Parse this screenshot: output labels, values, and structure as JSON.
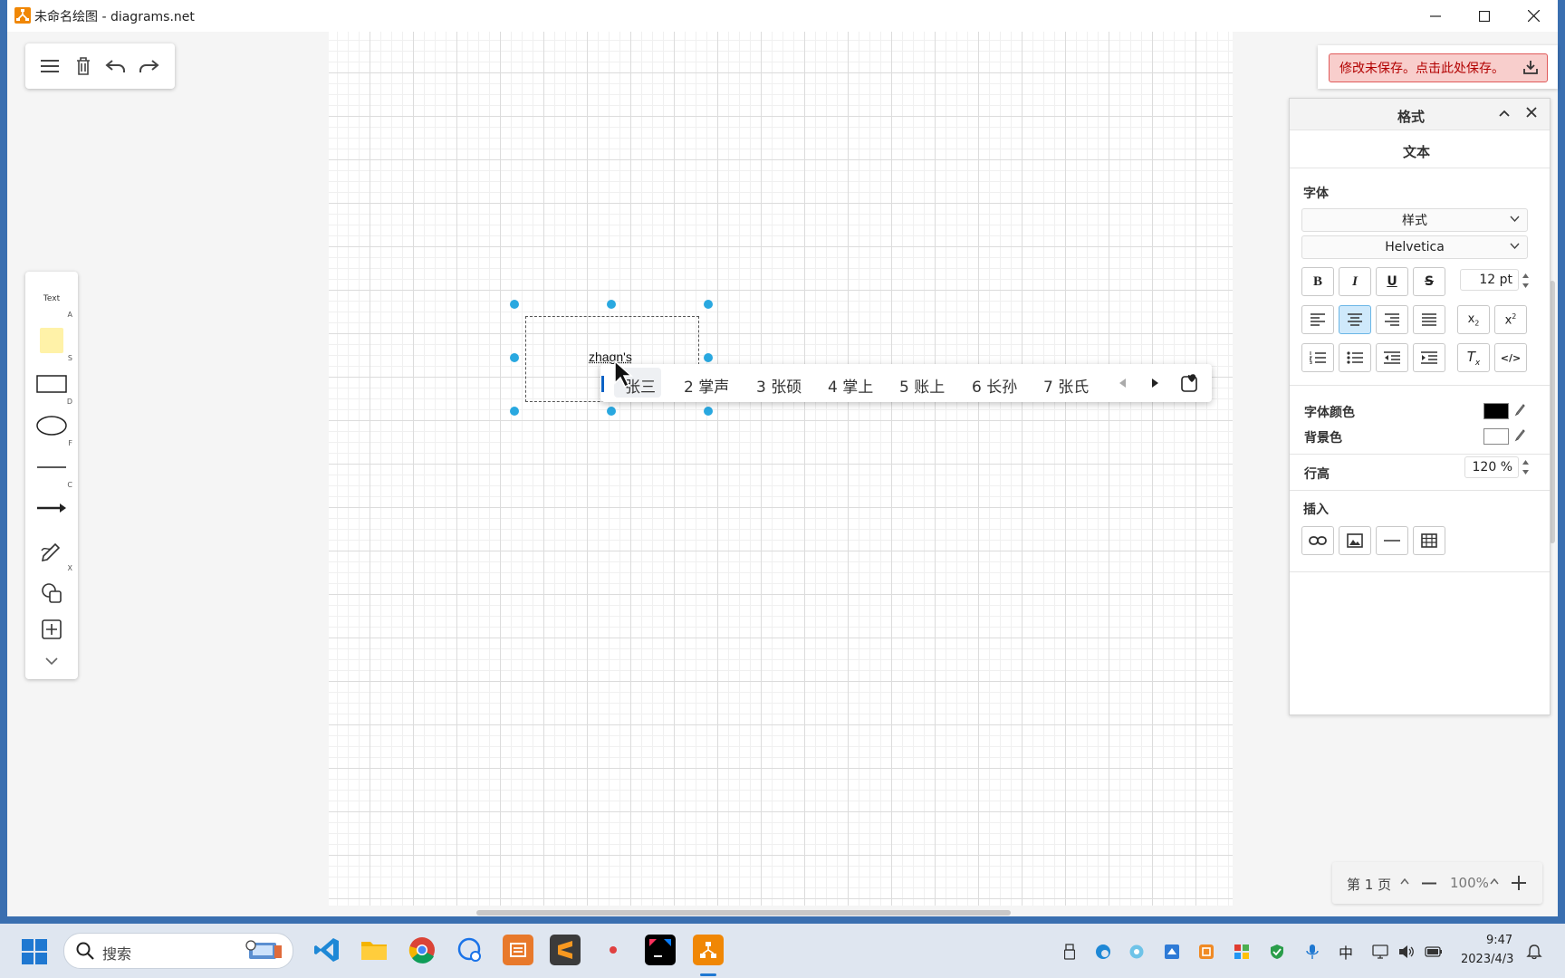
{
  "window": {
    "title": "未命名绘图 - diagrams.net"
  },
  "toolbar": {
    "items": [
      {
        "icon": "menu-icon"
      },
      {
        "icon": "trash-icon"
      },
      {
        "icon": "undo-icon"
      },
      {
        "icon": "redo-icon"
      }
    ]
  },
  "shapes": {
    "text_label": "Text",
    "keys": {
      "text": "A",
      "note": "S",
      "rect": "D",
      "ellipse": "F",
      "line": "C",
      "freehand": "X"
    }
  },
  "canvas": {
    "textbox_value": "zhagn's"
  },
  "ime": {
    "candidates": [
      "张三",
      "2 掌声",
      "3 张硕",
      "4 掌上",
      "5 账上",
      "6 长孙",
      "7 张氏"
    ]
  },
  "save_banner": {
    "label": "修改未保存。点击此处保存。"
  },
  "format_panel": {
    "header": "格式",
    "tab": "文本",
    "font_section": "字体",
    "style_select": "样式",
    "font_select": "Helvetica",
    "font_size": "12 pt",
    "font_color_label": "字体颜色",
    "bg_color_label": "背景色",
    "line_height_label": "行高",
    "line_height": "120 %",
    "insert_section": "插入",
    "colors": {
      "font": "#000000",
      "background": "#ffffff"
    }
  },
  "zoom": {
    "page": "第 1 页",
    "zoom": "100%"
  },
  "taskbar": {
    "search_placeholder": "搜索",
    "time": "9:47",
    "date": "2023/4/3",
    "ime_indicator": "中"
  },
  "colors": {
    "accent": "#29a8e0",
    "save_bg": "#f8cecc",
    "save_text": "#b20000"
  }
}
